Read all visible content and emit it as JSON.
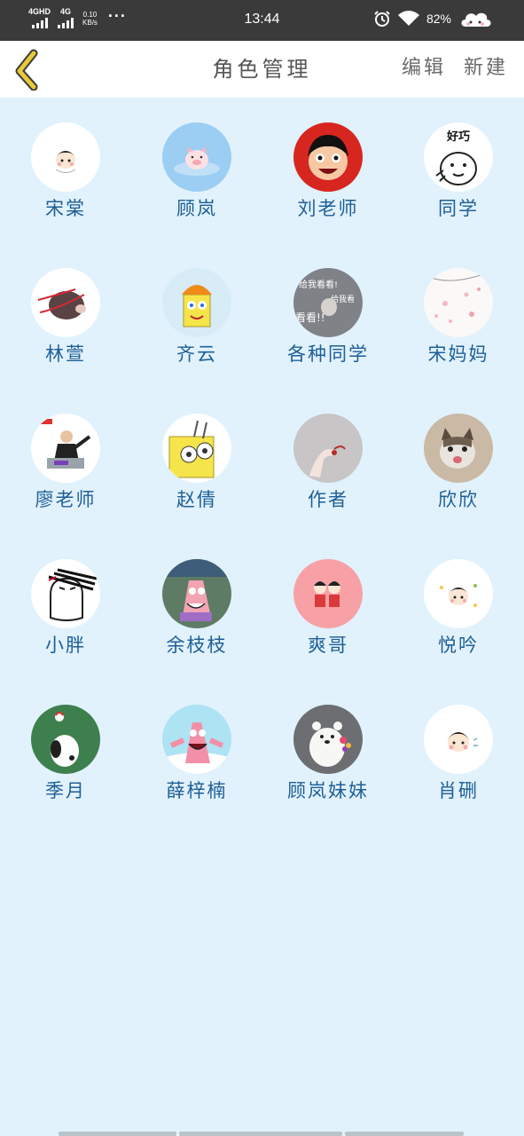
{
  "status_bar": {
    "network_1": "4GHD",
    "network_2": "4G",
    "speed_value": "0.10",
    "speed_unit": "KB/s",
    "more": "···",
    "time": "13:44",
    "battery": "82%",
    "icons": [
      "alarm-icon",
      "wifi-icon",
      "cloud-icon"
    ]
  },
  "nav": {
    "back_icon": "chevron-left-icon",
    "title": "角色管理",
    "edit_label": "编辑",
    "new_label": "新建",
    "back_color": "#e8c93a"
  },
  "colors": {
    "background": "#e1f2fc",
    "name_text": "#1e5f96",
    "navbar": "#ffffff",
    "statusbar": "#3a3a3a"
  },
  "characters": [
    {
      "name": "宋棠",
      "avatar": "cartoon-boy-white"
    },
    {
      "name": "顾岚",
      "avatar": "pig-bath-blue"
    },
    {
      "name": "刘老师",
      "avatar": "kid-face-red"
    },
    {
      "name": "同学",
      "avatar": "bear-meme-haoqiao"
    },
    {
      "name": "林萱",
      "avatar": "hamster-ribbon"
    },
    {
      "name": "齐云",
      "avatar": "spongebob-helmet"
    },
    {
      "name": "各种同学",
      "avatar": "meme-text-grey"
    },
    {
      "name": "宋妈妈",
      "avatar": "petals-white"
    },
    {
      "name": "廖老师",
      "avatar": "man-podium-meme"
    },
    {
      "name": "赵倩",
      "avatar": "spongebob-yellow"
    },
    {
      "name": "作者",
      "avatar": "hand-grey"
    },
    {
      "name": "欣欣",
      "avatar": "cat-photo"
    },
    {
      "name": "小胖",
      "avatar": "sketch-man"
    },
    {
      "name": "余枝枝",
      "avatar": "patrick-shelf"
    },
    {
      "name": "爽哥",
      "avatar": "couple-pink"
    },
    {
      "name": "悦吟",
      "avatar": "cartoon-boy-flowers"
    },
    {
      "name": "季月",
      "avatar": "snoopy-green"
    },
    {
      "name": "薛梓楠",
      "avatar": "patrick-sky"
    },
    {
      "name": "顾岚妹妹",
      "avatar": "polar-bear-flowers"
    },
    {
      "name": "肖硎",
      "avatar": "cartoon-boy-blush"
    }
  ],
  "meme_texts": {
    "haoqiao": "好巧",
    "gray_line1": "给我看看!",
    "gray_line2": "给我看",
    "gray_line3": "看看!!"
  }
}
